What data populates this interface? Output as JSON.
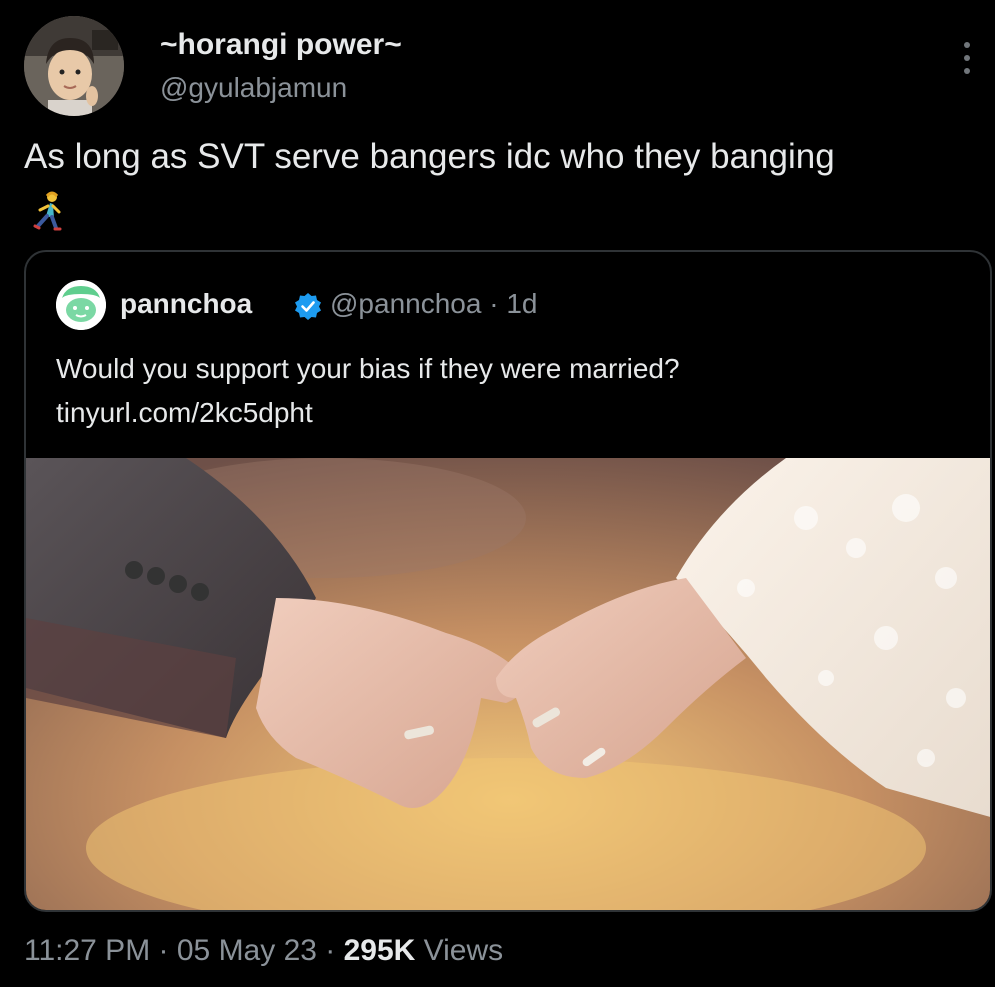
{
  "author": {
    "display_name": "~horangi power~",
    "handle": "@gyulabjamun"
  },
  "tweet": {
    "text": "As long as SVT serve bangers idc who they banging",
    "emoji": "woman-running-emoji"
  },
  "quoted": {
    "name": "pannchoa",
    "handle_time": "@pannchoa · 1d",
    "text": "Would you support your bias if they were married?",
    "link": "tinyurl.com/2kc5dpht",
    "photo": "wedding-hands-photo"
  },
  "meta": {
    "time": "11:27 PM",
    "sep1": " · ",
    "date": "05 May 23",
    "sep2": " · ",
    "views_count": "295K",
    "views_label": " Views"
  },
  "colors": {
    "background": "#000000",
    "text": "#e7e9ea",
    "secondary_text": "#8b9299",
    "border": "#2f3336",
    "verified": "#1d9bf0"
  }
}
